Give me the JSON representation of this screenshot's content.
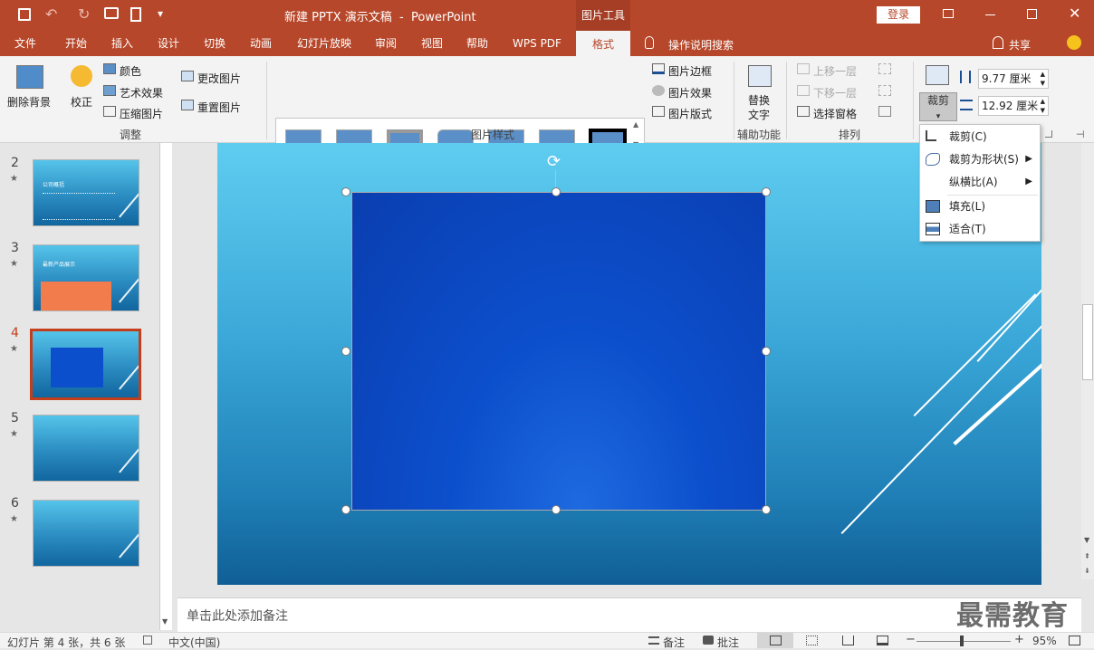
{
  "titlebar": {
    "doc_title": "新建 PPTX 演示文稿  -  PowerPoint",
    "context_tab": "图片工具",
    "login_label": "登录"
  },
  "tabs": [
    "文件",
    "开始",
    "插入",
    "设计",
    "切换",
    "动画",
    "幻灯片放映",
    "审阅",
    "视图",
    "帮助",
    "WPS PDF",
    "格式"
  ],
  "tell_me": "操作说明搜索",
  "share_label": "共享",
  "ribbon": {
    "remove_bg": "删除背景",
    "correct": "校正",
    "color": "颜色",
    "artistic": "艺术效果",
    "compress": "压缩图片",
    "change": "更改图片",
    "reset": "重置图片",
    "group_adjust": "调整",
    "border": "图片边框",
    "effects": "图片效果",
    "layout": "图片版式",
    "group_styles": "图片样式",
    "alt_text_1": "替换",
    "alt_text_2": "文字",
    "group_access": "辅助功能",
    "bring_forward": "上移一层",
    "send_backward": "下移一层",
    "selection_pane": "选择窗格",
    "group_arrange": "排列",
    "crop": "裁剪",
    "height": "9.77 厘米",
    "width": "12.92 厘米"
  },
  "crop_menu": {
    "items": [
      {
        "label": "裁剪(C)",
        "icon": "crop-icon",
        "submenu": false
      },
      {
        "label": "裁剪为形状(S)",
        "icon": "shape-icon",
        "submenu": true
      },
      {
        "label": "纵横比(A)",
        "icon": "",
        "submenu": true
      },
      {
        "label": "填充(L)",
        "icon": "fill-icon",
        "submenu": false
      },
      {
        "label": "适合(T)",
        "icon": "fit-icon",
        "submenu": false
      }
    ]
  },
  "slides": [
    {
      "num": "2",
      "title": "公司概括"
    },
    {
      "num": "3",
      "title": "最新产品展示"
    },
    {
      "num": "4",
      "title": ""
    },
    {
      "num": "5",
      "title": ""
    },
    {
      "num": "6",
      "title": ""
    }
  ],
  "selected_slide": "4",
  "notes_placeholder": "单击此处添加备注",
  "status": {
    "slide_info": "幻灯片 第 4 张，共 6 张",
    "language": "中文(中国)",
    "notes": "备注",
    "comments": "批注",
    "zoom": "95%"
  },
  "watermark": "最需教育",
  "colors": {
    "accent": "#b7472a",
    "ribbon_bg": "#f3f3f3"
  }
}
